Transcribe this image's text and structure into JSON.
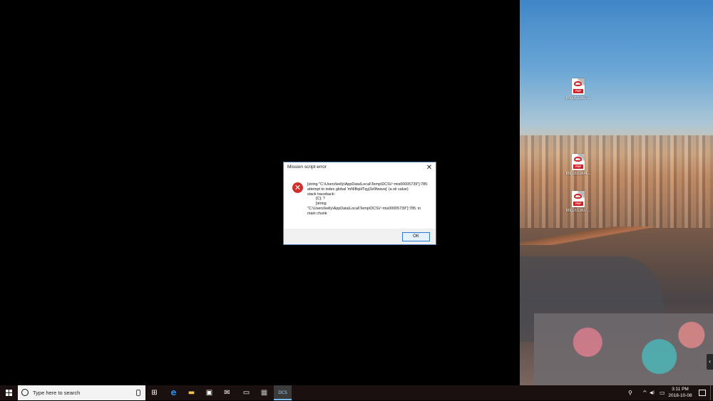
{
  "desktop": {
    "icons": [
      {
        "label": "Img201807..."
      },
      {
        "label": "Img201804..."
      },
      {
        "label": "Img201807..."
      }
    ],
    "pdf_badge": "PDF"
  },
  "dialog": {
    "title": "Mission script error",
    "close_glyph": "✕",
    "error_glyph": "✕",
    "message": "[string \"C:\\Users\\kelly\\AppData\\Local\\Temp\\DCS\\/~mis00005739\"]:785: attempt to index global 'mNIBqHTqyj3z0fwavej' (a nil value)\nstack traceback:\n        [C]: ?\n        [string \"C:\\Users\\kelly\\AppData\\Local\\Temp\\DCS\\/~mis00005739\"]:785: in main chunk",
    "ok_label": "OK"
  },
  "taskbar": {
    "search_placeholder": "Type here to search",
    "apps": [
      {
        "name": "task-view",
        "glyph": "⊞"
      },
      {
        "name": "edge",
        "glyph": "e"
      },
      {
        "name": "file-explorer",
        "glyph": "▬"
      },
      {
        "name": "store",
        "glyph": "▣"
      },
      {
        "name": "mail",
        "glyph": "✉"
      },
      {
        "name": "app-black",
        "glyph": "▭"
      },
      {
        "name": "app-game",
        "glyph": "▦"
      },
      {
        "name": "dcs",
        "glyph": "DCS"
      }
    ],
    "tray": {
      "people_glyph": "⚲",
      "chevron_glyph": "^",
      "volume_glyph": "◀)",
      "network_glyph": "▭"
    },
    "time": "3:11 PM",
    "date": "2018-10-08",
    "scroll_arrow": "‹"
  },
  "colors": {
    "taskbar_bg": "#1a1010",
    "dialog_border": "#4f7fc0",
    "error_red": "#d0302a",
    "ok_border": "#2d7ad6"
  }
}
